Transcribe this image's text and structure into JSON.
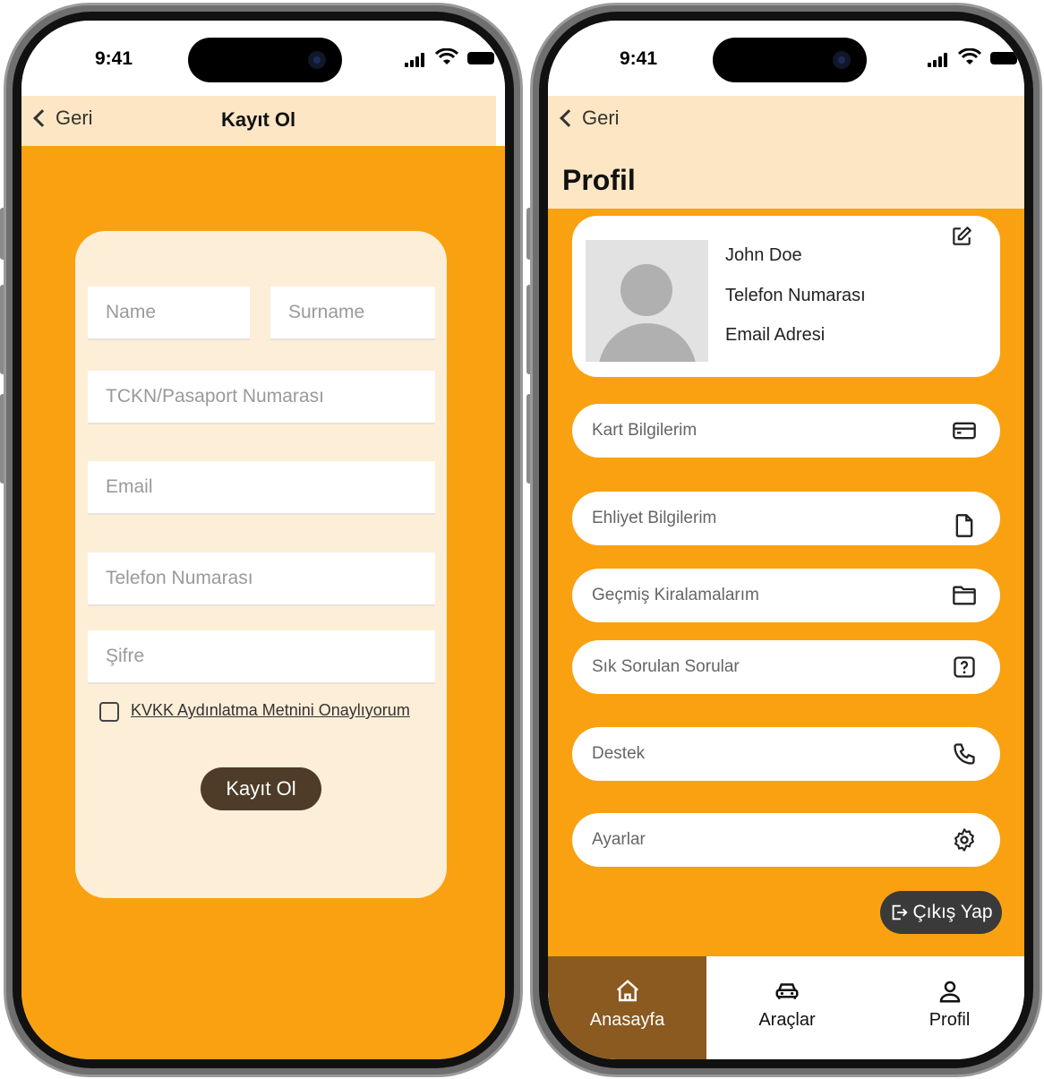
{
  "status_bar": {
    "time": "9:41"
  },
  "register_screen": {
    "back_label": "Geri",
    "title": "Kayıt Ol",
    "fields": {
      "name_placeholder": "Name",
      "surname_placeholder": "Surname",
      "id_placeholder": "TCKN/Pasaport Numarası",
      "email_placeholder": "Email",
      "phone_placeholder": "Telefon Numarası",
      "password_placeholder": "Şifre"
    },
    "consent_label": "KVKK Aydınlatma Metnini Onaylıyorum",
    "submit_label": "Kayıt Ol"
  },
  "profile_screen": {
    "back_label": "Geri",
    "title": "Profil",
    "user": {
      "name": "John Doe",
      "phone": "Telefon Numarası",
      "email": "Email Adresi"
    },
    "menu": [
      {
        "label": "Kart Bilgilerim",
        "icon": "credit-card-icon"
      },
      {
        "label": "Ehliyet Bilgilerim",
        "icon": "document-icon"
      },
      {
        "label": "Geçmiş Kiralamalarım",
        "icon": "folder-icon"
      },
      {
        "label": "Sık Sorulan Sorular",
        "icon": "help-icon"
      },
      {
        "label": "Destek",
        "icon": "phone-icon"
      },
      {
        "label": "Ayarlar",
        "icon": "gear-icon"
      }
    ],
    "logout_label": "Çıkış Yap",
    "tabs": [
      {
        "label": "Anasayfa",
        "icon": "home-icon",
        "active": true
      },
      {
        "label": "Araçlar",
        "icon": "car-icon",
        "active": false
      },
      {
        "label": "Profil",
        "icon": "user-icon",
        "active": false
      }
    ]
  },
  "colors": {
    "accent_orange": "#f9a111",
    "header_cream": "#fde6c3",
    "card_cream": "#fdeed8",
    "button_brown": "#4e3c28",
    "active_tab_brown": "#8a5a20",
    "logout_dark": "#3a3a3a"
  }
}
